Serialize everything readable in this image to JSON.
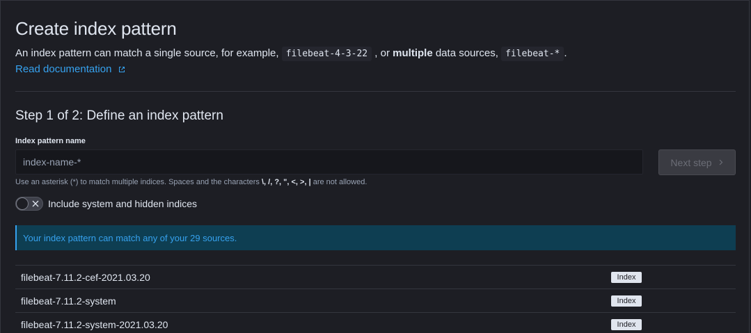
{
  "header": {
    "title": "Create index pattern",
    "desc_part1": "An index pattern can match a single source, for example,",
    "example_single": "filebeat-4-3-22",
    "desc_part2": ", or",
    "desc_bold": "multiple",
    "desc_part3": "data sources,",
    "example_multi": "filebeat-*",
    "desc_part4": ".",
    "doc_link": "Read documentation"
  },
  "step": {
    "title": "Step 1 of 2: Define an index pattern",
    "field_label": "Index pattern name",
    "placeholder": "index-name-*",
    "value": "",
    "next_label": "Next step",
    "help_prefix": "Use an asterisk (*) to match multiple indices. Spaces and the characters",
    "help_chars": "\\, /, ?, \", <, >, |",
    "help_suffix": "are not allowed.",
    "toggle_label": "Include system and hidden indices",
    "toggle_on": false
  },
  "callout": {
    "text": "Your index pattern can match any of your 29 sources."
  },
  "indices": [
    {
      "name": "filebeat-7.11.2-cef-2021.03.20",
      "type": "Index"
    },
    {
      "name": "filebeat-7.11.2-system",
      "type": "Index"
    },
    {
      "name": "filebeat-7.11.2-system-2021.03.20",
      "type": "Index"
    }
  ],
  "colors": {
    "background": "#1d1e24",
    "link": "#36a2ef",
    "callout_bg": "#0e3e52",
    "text": "#dfe5ef",
    "subdued": "#98a2b3"
  },
  "icons": {
    "doc_link": "external-link-icon",
    "next_step": "chevron-right-icon",
    "toggle": "cross-icon"
  }
}
